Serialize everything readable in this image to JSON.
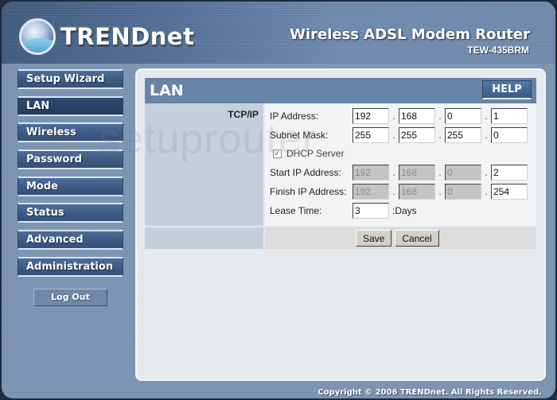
{
  "header": {
    "brand": "TRENDnet",
    "product_title": "Wireless ADSL Modem Router",
    "model": "TEW-435BRM"
  },
  "sidebar": {
    "items": [
      {
        "label": "Setup Wizard",
        "active": false
      },
      {
        "label": "LAN",
        "active": true
      },
      {
        "label": "Wireless",
        "active": false
      },
      {
        "label": "Password",
        "active": false
      },
      {
        "label": "Mode",
        "active": false
      },
      {
        "label": "Status",
        "active": false
      },
      {
        "label": "Advanced",
        "active": false
      },
      {
        "label": "Administration",
        "active": false
      }
    ],
    "logout_label": "Log Out"
  },
  "panel": {
    "title": "LAN",
    "help_label": "HELP",
    "section_label": "TCP/IP",
    "ip_address": {
      "label": "IP Address:",
      "octets": [
        "192",
        "168",
        "0",
        "1"
      ]
    },
    "subnet_mask": {
      "label": "Subnet Mask:",
      "octets": [
        "255",
        "255",
        "255",
        "0"
      ]
    },
    "dhcp_server": {
      "label": "DHCP Server",
      "checked": true,
      "check_glyph": "✓"
    },
    "start_ip": {
      "label": "Start IP Address:",
      "octets": [
        "192",
        "168",
        "0",
        "2"
      ]
    },
    "finish_ip": {
      "label": "Finish IP Address:",
      "octets": [
        "192",
        "168",
        "0",
        "254"
      ]
    },
    "lease_time": {
      "label": "Lease Time:",
      "value": "3",
      "unit": ":Days"
    },
    "save_label": "Save",
    "cancel_label": "Cancel"
  },
  "watermark": "setuprouter",
  "footer": {
    "copyright": "Copyright © 2006 TRENDnet. All Rights Reserved."
  },
  "colors": {
    "panel_header": "#6784a8",
    "nav_button": "#3c5a84",
    "nav_button_active": "#233b5c",
    "frame_bg": "#7f97b4"
  }
}
